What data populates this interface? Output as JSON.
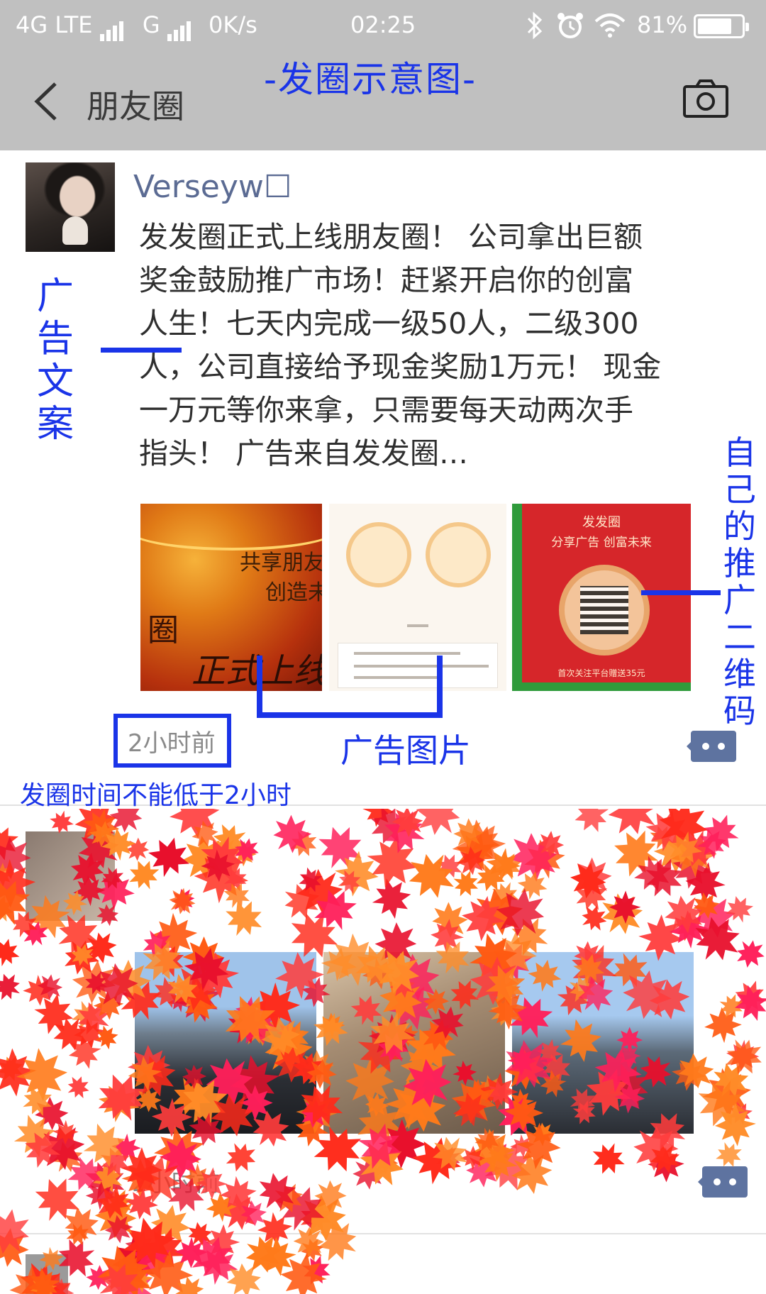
{
  "status_bar": {
    "network_1": "4G LTE",
    "network_2": "G",
    "speed": "0K/s",
    "time": "02:25",
    "battery": "81%",
    "battery_level": 0.81
  },
  "header": {
    "title": "朋友圈",
    "caption": "-发圈示意图-"
  },
  "post1": {
    "username": "Verseyw☐",
    "text_lines": [
      "发发圈正式上线朋友圈！ 公司拿出巨额",
      "奖金鼓励推广市场！赶紧开启你的创富",
      "人生！七天内完成一级50人，二级300",
      "人，公司直接给予现金奖励1万元！ 现金",
      "一万元等你来拿，只需要每天动两次手",
      "指头！ 广告来自发发圈…"
    ],
    "img1": {
      "t1": "共享朋友",
      "t2": "创造未",
      "t3": "正式上线",
      "t4": "圈"
    },
    "img3": {
      "title": "发发圈",
      "subtitle": "分享广告  创富未来",
      "bottom": "首次关注平台赠送35元"
    },
    "time": "2小时前"
  },
  "annotations": {
    "ad_copy": [
      "广",
      "告",
      "文",
      "案"
    ],
    "qr": [
      "自",
      "己",
      "的",
      "推",
      "广",
      "二",
      "维",
      "码"
    ],
    "ad_images": "广告图片",
    "time_note": "发圈时间不能低于2小时"
  },
  "post2": {
    "time": "2小时前"
  },
  "colors": {
    "annotation_blue": "#1a34e8",
    "header_gray": "#c0c0c0",
    "username_blue": "#5b6b93"
  }
}
